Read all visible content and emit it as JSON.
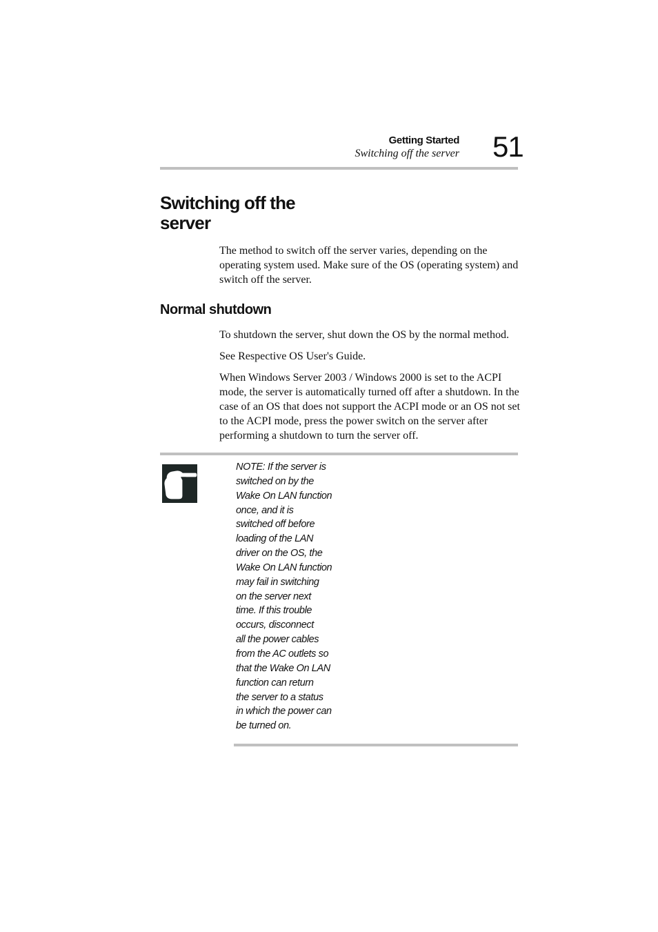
{
  "running_header": {
    "chapter": "Getting Started",
    "section": "Switching off the server",
    "page_number": "51"
  },
  "section": {
    "title": "Switching off the server",
    "intro": "The method to switch off the server varies, depending on the operating system used. Make sure of the OS (operating system) and switch off the server."
  },
  "subsection": {
    "title": "Normal shutdown",
    "paragraphs": [
      "To shutdown the server, shut down the OS by the normal method.",
      "See Respective OS User's Guide.",
      "When Windows Server 2003 / Windows 2000 is set to the ACPI mode, the server is automatically turned off after a shutdown. In the case of an OS that does not support the ACPI mode or an OS not set to the ACPI mode, press the power switch on the server after performing a shutdown to turn the server off."
    ]
  },
  "note": {
    "icon": "pointing-hand-icon",
    "lines": [
      "NOTE: If the server is",
      "switched on by the",
      "Wake On LAN function",
      "once, and it is",
      "switched off before",
      "loading of the LAN",
      "driver on the OS, the",
      "Wake On LAN function",
      "may fail in switching",
      "on the server next",
      "time. If this trouble",
      "occurs, disconnect",
      "all the power cables",
      "from the AC outlets so",
      "that the Wake On LAN",
      "function can return",
      "the server to a status",
      "in which the power can",
      "be turned on."
    ]
  }
}
